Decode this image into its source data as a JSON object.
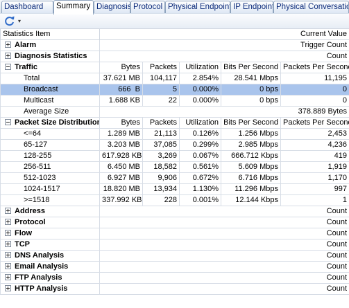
{
  "tabs": [
    "Dashboard",
    "Summary",
    "Diagnosis",
    "Protocol",
    "Physical Endpoint",
    "IP Endpoint",
    "Physical Conversation"
  ],
  "active_tab": 1,
  "toolbar": {
    "refresh_icon": "refresh-icon",
    "dropdown_arrow": "▾"
  },
  "header": {
    "item": "Statistics Item",
    "value": "Current Value"
  },
  "stat_cols": [
    "Bytes",
    "Packets",
    "Utilization",
    "Bits Per Second",
    "Packets Per Second"
  ],
  "sections": {
    "alarm": {
      "label": "Alarm",
      "value": "Trigger Count"
    },
    "diagnosis": {
      "label": "Diagnosis Statistics",
      "value": "Count"
    },
    "traffic": {
      "label": "Traffic",
      "rows": [
        {
          "name": "Total",
          "bytes": "37.621 MB",
          "packets": "104,117",
          "util": "2.854%",
          "bps": "28.541 Mbps",
          "pps": "11,195"
        },
        {
          "name": "Broadcast",
          "bytes": "666  B",
          "packets": "5",
          "util": "0.000%",
          "bps": "0 bps",
          "pps": "0"
        },
        {
          "name": "Multicast",
          "bytes": "1.688 KB",
          "packets": "22",
          "util": "0.000%",
          "bps": "0 bps",
          "pps": "0"
        }
      ],
      "average": {
        "name": "Average Size",
        "value": "378.889 Bytes"
      }
    },
    "psd": {
      "label": "Packet Size Distribution",
      "rows": [
        {
          "name": "<=64",
          "bytes": "1.289 MB",
          "packets": "21,113",
          "util": "0.126%",
          "bps": "1.256 Mbps",
          "pps": "2,453"
        },
        {
          "name": "65-127",
          "bytes": "3.203 MB",
          "packets": "37,085",
          "util": "0.299%",
          "bps": "2.985 Mbps",
          "pps": "4,236"
        },
        {
          "name": "128-255",
          "bytes": "617.928 KB",
          "packets": "3,269",
          "util": "0.067%",
          "bps": "666.712 Kbps",
          "pps": "419"
        },
        {
          "name": "256-511",
          "bytes": "6.450 MB",
          "packets": "18,582",
          "util": "0.561%",
          "bps": "5.609 Mbps",
          "pps": "1,919"
        },
        {
          "name": "512-1023",
          "bytes": "6.927 MB",
          "packets": "9,906",
          "util": "0.672%",
          "bps": "6.716 Mbps",
          "pps": "1,170"
        },
        {
          "name": "1024-1517",
          "bytes": "18.820 MB",
          "packets": "13,934",
          "util": "1.130%",
          "bps": "11.296 Mbps",
          "pps": "997"
        },
        {
          "name": ">=1518",
          "bytes": "337.992 KB",
          "packets": "228",
          "util": "0.001%",
          "bps": "12.144 Kbps",
          "pps": "1"
        }
      ]
    },
    "collapsed": [
      {
        "label": "Address",
        "value": "Count"
      },
      {
        "label": "Protocol",
        "value": "Count"
      },
      {
        "label": "Flow",
        "value": "Count"
      },
      {
        "label": "TCP",
        "value": "Count"
      },
      {
        "label": "DNS Analysis",
        "value": "Count"
      },
      {
        "label": "Email Analysis",
        "value": "Count"
      },
      {
        "label": "FTP Analysis",
        "value": "Count"
      },
      {
        "label": "HTTP Analysis",
        "value": "Count"
      }
    ]
  },
  "colors": {
    "selected_row": "#a9c4ec",
    "tab_text": "#0b2a7a"
  }
}
